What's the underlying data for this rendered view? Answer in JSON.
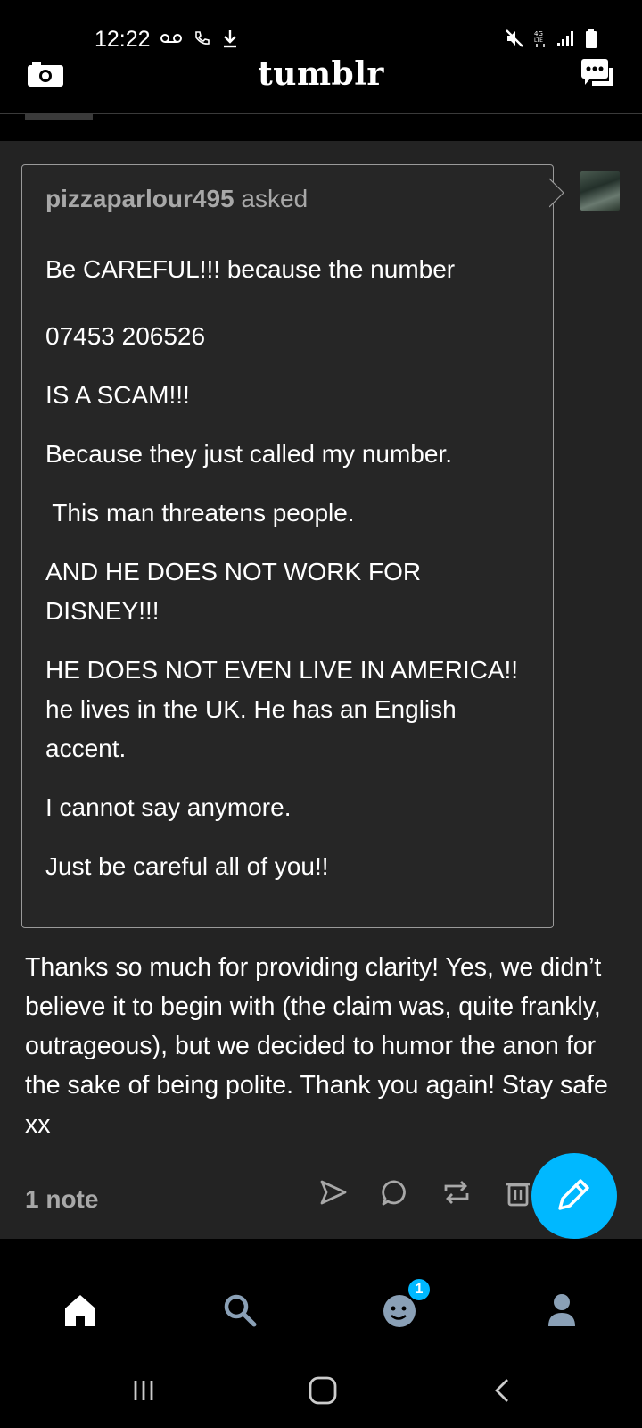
{
  "status_bar": {
    "time": "12:22"
  },
  "header": {
    "logo": "tumblr"
  },
  "ask": {
    "username": "pizzaparlour495",
    "asked_label": "asked",
    "paragraphs": [
      "Be CAREFUL!!! because the number",
      "07453 206526",
      "IS A SCAM!!!",
      "Because they just called my number.",
      " This man threatens people.",
      "AND HE DOES NOT WORK FOR DISNEY!!!",
      "HE DOES NOT EVEN LIVE IN AMERICA!! he lives in the UK. He has an English accent.",
      "I cannot say anymore.",
      "Just be careful all of you!!"
    ]
  },
  "answer": {
    "text": "Thanks so much for providing clarity! Yes, we didn’t believe it to begin with (the claim was, quite frankly, outrageous), but we decided to humor the anon for the sake of being polite. Thank you again! Stay safe xx"
  },
  "post_footer": {
    "notes": "1 note"
  },
  "bottom_nav": {
    "activity_badge": "1"
  },
  "colors": {
    "accent": "#00b8ff",
    "card_bg": "#232323",
    "muted_text": "#a8a8a8"
  }
}
